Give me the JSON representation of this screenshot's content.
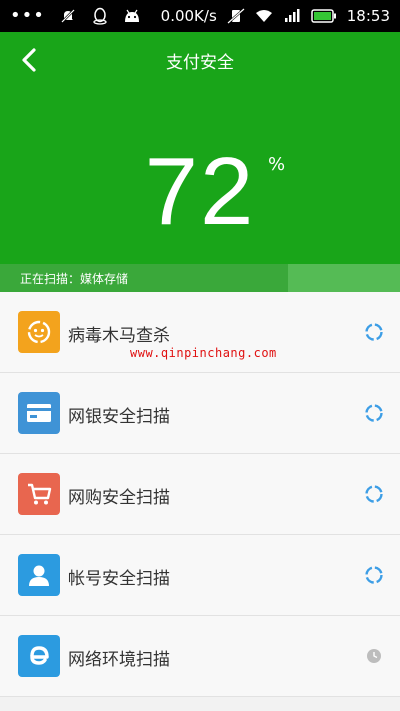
{
  "statusbar": {
    "dots": "•••",
    "speed": "0.00K/s",
    "time": "18:53"
  },
  "header": {
    "back_icon": "chevron-left-icon",
    "title": "支付安全",
    "percent": "72",
    "percent_sign": "%",
    "progress_fraction": 0.72,
    "scan_status": "正在扫描：媒体存储"
  },
  "watermark": "www.qinpinchang.com",
  "list": {
    "items": [
      {
        "label": "病毒木马查杀",
        "icon": "virus-scan-icon",
        "icon_color": "#f3a31d",
        "status": "spinner"
      },
      {
        "label": "网银安全扫描",
        "icon": "bank-card-icon",
        "icon_color": "#3f93d6",
        "status": "spinner"
      },
      {
        "label": "网购安全扫描",
        "icon": "shopping-cart-icon",
        "icon_color": "#e8664f",
        "status": "spinner"
      },
      {
        "label": "帐号安全扫描",
        "icon": "account-user-icon",
        "icon_color": "#2c9be0",
        "status": "spinner"
      },
      {
        "label": "网络环境扫描",
        "icon": "network-ie-icon",
        "icon_color": "#2c9be0",
        "status": "pending-clock"
      }
    ]
  },
  "colors": {
    "header_green": "#19a519",
    "spinner_blue": "#3d9ee6",
    "pending_gray": "#bdbdbd"
  }
}
